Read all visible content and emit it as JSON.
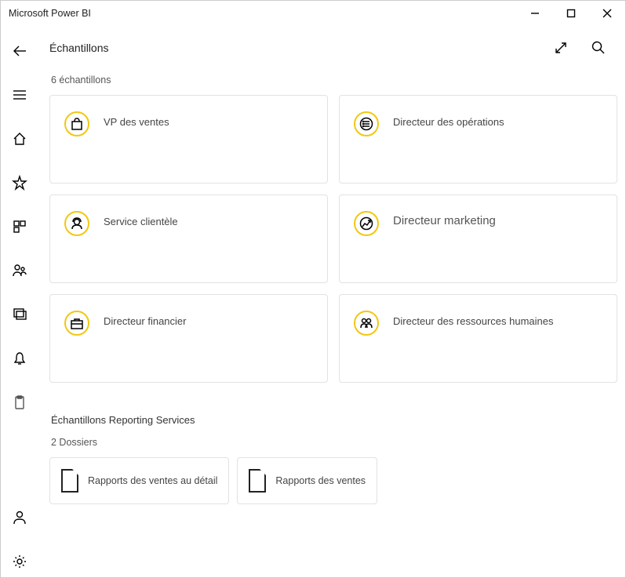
{
  "window": {
    "title": "Microsoft Power BI"
  },
  "page": {
    "title": "Échantillons",
    "count_label": "6 échantillons",
    "subheader": "Échantillons Reporting Services",
    "folders_count": "2 Dossiers"
  },
  "samples": [
    {
      "label": "VP des ventes",
      "icon": "shopping-bag"
    },
    {
      "label": "Directeur des opérations",
      "icon": "list"
    },
    {
      "label": "Service clientèle",
      "icon": "headset"
    },
    {
      "label": "Directeur marketing",
      "icon": "chart-up",
      "big": true
    },
    {
      "label": "Directeur financier",
      "icon": "briefcase"
    },
    {
      "label": "Directeur des ressources humaines",
      "icon": "people"
    }
  ],
  "folders": [
    {
      "label": "Rapports des ventes au détail"
    },
    {
      "label": "Rapports des ventes"
    }
  ]
}
